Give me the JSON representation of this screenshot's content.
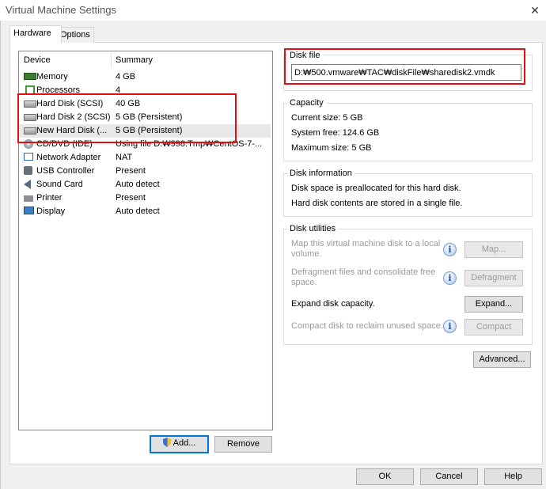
{
  "window": {
    "title": "Virtual Machine Settings",
    "close_glyph": "✕"
  },
  "tabs": [
    {
      "label": "Hardware",
      "active": true
    },
    {
      "label": "Options",
      "active": false
    }
  ],
  "device_list": {
    "headers": {
      "device": "Device",
      "summary": "Summary"
    },
    "rows": [
      {
        "device": "Memory",
        "summary": "4 GB",
        "icon": "memory-icon"
      },
      {
        "device": "Processors",
        "summary": "4",
        "icon": "processor-icon"
      },
      {
        "device": "Hard Disk (SCSI)",
        "summary": "40 GB",
        "icon": "hard-disk-icon"
      },
      {
        "device": "Hard Disk 2 (SCSI)",
        "summary": "5 GB (Persistent)",
        "icon": "hard-disk-icon"
      },
      {
        "device": "New Hard Disk (...",
        "summary": "5 GB (Persistent)",
        "icon": "hard-disk-icon",
        "selected": true
      },
      {
        "device": "CD/DVD (IDE)",
        "summary": "Using file D:₩998.Tmp₩CentOS-7-...",
        "icon": "cd-dvd-icon"
      },
      {
        "device": "Network Adapter",
        "summary": "NAT",
        "icon": "network-adapter-icon"
      },
      {
        "device": "USB Controller",
        "summary": "Present",
        "icon": "usb-icon"
      },
      {
        "device": "Sound Card",
        "summary": "Auto detect",
        "icon": "sound-card-icon"
      },
      {
        "device": "Printer",
        "summary": "Present",
        "icon": "printer-icon"
      },
      {
        "device": "Display",
        "summary": "Auto detect",
        "icon": "display-icon"
      }
    ]
  },
  "list_buttons": {
    "add": "Add...",
    "remove": "Remove"
  },
  "disk_file": {
    "title": "Disk file",
    "path": "D:₩500.vmware₩TAC₩diskFile₩sharedisk2.vmdk"
  },
  "capacity": {
    "title": "Capacity",
    "current_size": "Current size:  5 GB",
    "system_free": "System free:  124.6 GB",
    "maximum_size": "Maximum size:  5 GB"
  },
  "disk_information": {
    "title": "Disk information",
    "line1": "Disk space is preallocated for this hard disk.",
    "line2": "Hard disk contents are stored in a single file."
  },
  "disk_utilities": {
    "title": "Disk utilities",
    "map_desc_1": "Map this virtual machine disk to a local",
    "map_desc_2": "volume.",
    "map_button": "Map...",
    "defrag_desc_1": "Defragment files and consolidate free",
    "defrag_desc_2": "space.",
    "defrag_button": "Defragment",
    "expand_desc": "Expand disk capacity.",
    "expand_button": "Expand...",
    "compact_desc": "Compact disk to reclaim unused space.",
    "compact_button": "Compact",
    "info_glyph": "i"
  },
  "advanced_button": "Advanced...",
  "dialog_buttons": {
    "ok": "OK",
    "cancel": "Cancel",
    "help": "Help"
  },
  "colors": {
    "highlight_red": "#e01010",
    "accent_blue": "#0078d7"
  }
}
